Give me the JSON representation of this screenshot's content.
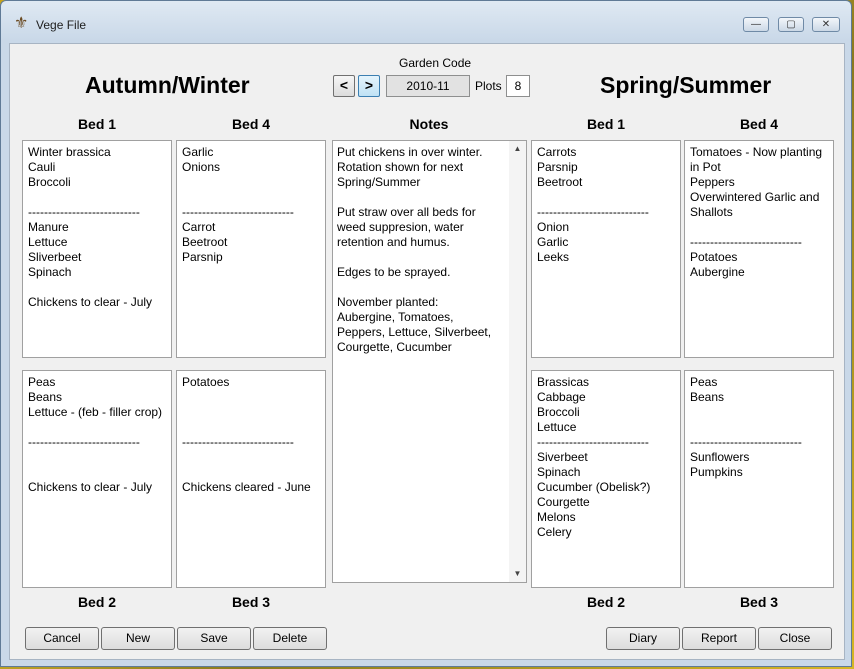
{
  "window": {
    "title": "Vege File",
    "controls": {
      "minimize": "—",
      "maximize": "▢",
      "close": "✕"
    }
  },
  "header": {
    "left_section": "Autumn/Winter",
    "right_section": "Spring/Summer",
    "garden_code_label": "Garden Code",
    "prev_label": "<",
    "next_label": ">",
    "garden_code": "2010-11",
    "plots_label": "Plots",
    "plots_value": "8"
  },
  "labels": {
    "bed1": "Bed 1",
    "bed2": "Bed 2",
    "bed3": "Bed 3",
    "bed4": "Bed 4",
    "notes": "Notes"
  },
  "autumn_winter": {
    "bed1": [
      "Winter brassica",
      "Cauli",
      "Broccoli",
      "",
      "----------------------------",
      "Manure",
      "Lettuce",
      "Sliverbeet",
      "Spinach",
      "",
      "Chickens to clear - July"
    ],
    "bed4": [
      "Garlic",
      "Onions",
      "",
      "",
      "----------------------------",
      "Carrot",
      "Beetroot",
      "Parsnip"
    ],
    "bed2": [
      "Peas",
      "Beans",
      "Lettuce - (feb - filler crop)",
      "",
      "----------------------------",
      "",
      "",
      "Chickens to clear - July"
    ],
    "bed3": [
      "Potatoes",
      "",
      "",
      "",
      "----------------------------",
      "",
      "",
      "Chickens cleared - June"
    ]
  },
  "notes": [
    "Put chickens in over winter.",
    "Rotation shown for next",
    "Spring/Summer",
    "",
    "Put straw over all beds for",
    "weed suppresion, water",
    "retention and humus.",
    "",
    "Edges to be sprayed.",
    "",
    "November planted:",
    "Aubergine, Tomatoes,",
    "Peppers, Lettuce, Silverbeet,",
    "Courgette, Cucumber"
  ],
  "spring_summer": {
    "bed1": [
      "Carrots",
      "Parsnip",
      "Beetroot",
      "",
      "----------------------------",
      "Onion",
      "Garlic",
      "Leeks"
    ],
    "bed4": [
      "Tomatoes - Now planting",
      "in Pot",
      "Peppers",
      "Overwintered Garlic and",
      "Shallots",
      "",
      "----------------------------",
      "Potatoes",
      "Aubergine"
    ],
    "bed2": [
      "Brassicas",
      "Cabbage",
      "Broccoli",
      "Lettuce",
      "----------------------------",
      "Siverbeet",
      "Spinach",
      "Cucumber (Obelisk?)",
      "Courgette",
      "Melons",
      "Celery"
    ],
    "bed3": [
      "Peas",
      "Beans",
      "",
      "",
      "----------------------------",
      "Sunflowers",
      "Pumpkins"
    ]
  },
  "buttons": {
    "cancel": "Cancel",
    "new": "New",
    "save": "Save",
    "delete": "Delete",
    "diary": "Diary",
    "report": "Report",
    "close": "Close"
  }
}
